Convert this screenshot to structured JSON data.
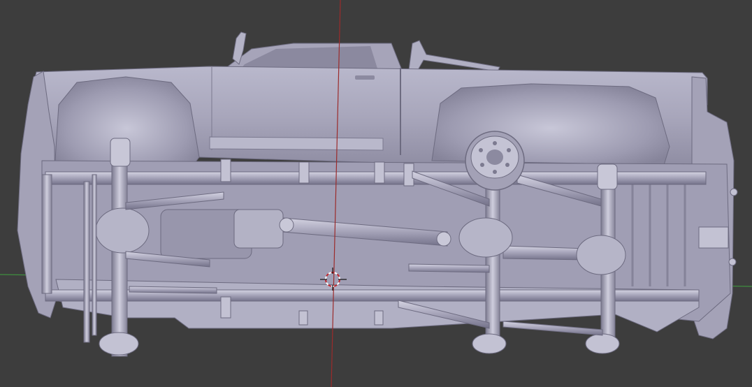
{
  "viewport": {
    "background_color": "#3d3d3d",
    "model_color": "#a9a7bd",
    "model_shadow_color": "#7d7b90",
    "model_highlight_color": "#d2d1e0",
    "axis_x_color": "#3f8f3f",
    "axis_z_color": "#9b2b2b",
    "cursor_icon": "3d-cursor-icon",
    "object": "pickup-truck-chassis-underside"
  }
}
